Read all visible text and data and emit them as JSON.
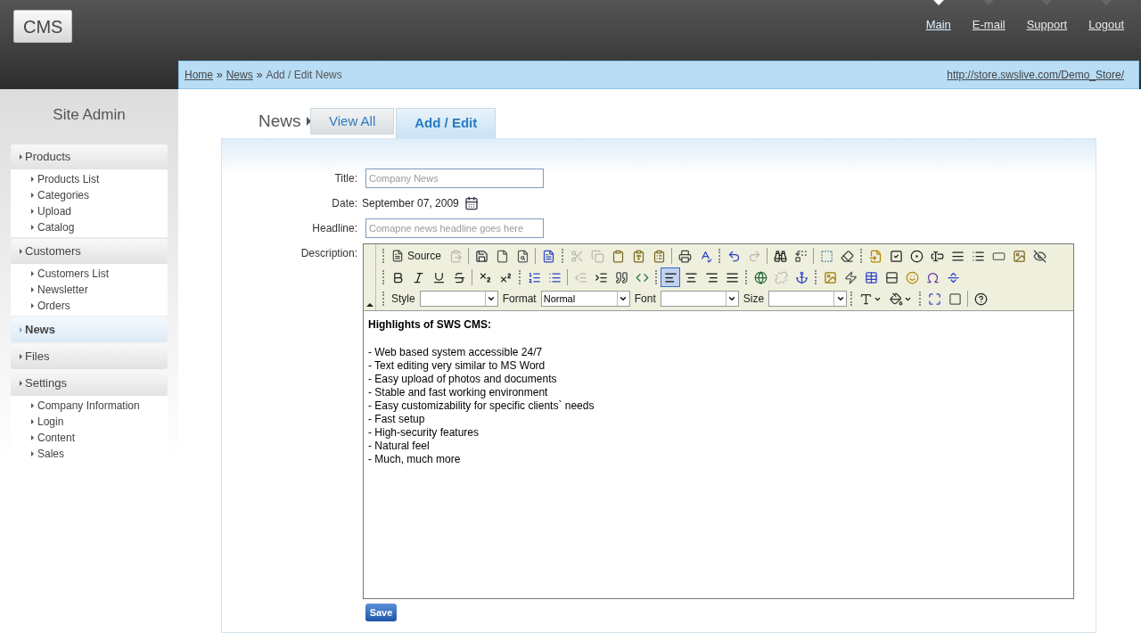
{
  "logo": "CMS",
  "nav": [
    {
      "label": "Main",
      "selected": true
    },
    {
      "label": "E-mail",
      "selected": false
    },
    {
      "label": "Support",
      "selected": false
    },
    {
      "label": "Logout",
      "selected": false
    }
  ],
  "breadcrumb": {
    "links": [
      "Home",
      "News"
    ],
    "separator": "»",
    "current": "Add / Edit News",
    "store_url": "http://store.swslive.com/Demo_Store/"
  },
  "sidebar": {
    "title": "Site Admin",
    "groups": [
      {
        "label": "Products",
        "selected": false,
        "children": [
          "Products List",
          "Categories",
          "Upload",
          "Catalog"
        ]
      },
      {
        "label": "Customers",
        "selected": false,
        "children": [
          "Customers List",
          "Newsletter",
          "Orders"
        ]
      },
      {
        "label": "News",
        "selected": true
      },
      {
        "label": "Files",
        "selected": false
      },
      {
        "label": "Settings",
        "selected": false,
        "children": [
          "Company Information",
          "Login",
          "Content",
          "Sales"
        ]
      }
    ]
  },
  "section": "News",
  "tabs": [
    {
      "label": "View All",
      "selected": false
    },
    {
      "label": "Add / Edit",
      "selected": true
    }
  ],
  "form": {
    "title": {
      "label": "Title:",
      "placeholder": "Company News"
    },
    "date": {
      "label": "Date:",
      "value": "September 07, 2009"
    },
    "headline": {
      "label": "Headline:",
      "placeholder": "Comapne news headline goes here"
    },
    "description": {
      "label": "Description:"
    }
  },
  "toolbar": {
    "rows": [
      [
        {
          "kind": "grip"
        },
        {
          "kind": "source",
          "label": "Source"
        },
        {
          "kind": "icon",
          "disabled": true,
          "selected": false
        },
        {
          "kind": "sep"
        },
        {
          "kind": "icon",
          "disabled": false,
          "selected": false
        },
        {
          "kind": "icon",
          "disabled": false,
          "selected": false
        },
        {
          "kind": "icon",
          "disabled": false,
          "selected": false
        },
        {
          "kind": "sep"
        },
        {
          "kind": "icon",
          "disabled": false,
          "selected": false
        },
        {
          "kind": "grip"
        },
        {
          "kind": "icon",
          "disabled": true,
          "selected": false
        },
        {
          "kind": "icon",
          "disabled": true,
          "selected": false
        },
        {
          "kind": "icon",
          "disabled": false,
          "selected": false
        },
        {
          "kind": "icon",
          "disabled": false,
          "selected": false
        },
        {
          "kind": "icon",
          "disabled": false,
          "selected": false
        },
        {
          "kind": "sep"
        },
        {
          "kind": "icon",
          "disabled": false,
          "selected": false
        },
        {
          "kind": "icon",
          "disabled": false,
          "selected": false
        },
        {
          "kind": "grip"
        },
        {
          "kind": "icon",
          "disabled": false,
          "selected": false
        },
        {
          "kind": "icon",
          "disabled": true,
          "selected": false
        },
        {
          "kind": "sep"
        },
        {
          "kind": "icon",
          "disabled": false,
          "selected": false
        },
        {
          "kind": "icon",
          "disabled": false,
          "selected": false
        },
        {
          "kind": "sep"
        },
        {
          "kind": "icon",
          "disabled": false,
          "selected": false
        },
        {
          "kind": "icon",
          "disabled": false,
          "selected": false
        },
        {
          "kind": "grip"
        },
        {
          "kind": "icon",
          "disabled": false,
          "selected": false
        },
        {
          "kind": "icon",
          "disabled": false,
          "selected": false
        },
        {
          "kind": "icon",
          "disabled": false,
          "selected": false
        },
        {
          "kind": "icon",
          "disabled": false,
          "selected": false
        },
        {
          "kind": "icon",
          "disabled": false,
          "selected": false
        },
        {
          "kind": "icon",
          "disabled": false,
          "selected": false
        },
        {
          "kind": "icon",
          "disabled": false,
          "selected": false
        },
        {
          "kind": "icon",
          "disabled": false,
          "selected": false
        },
        {
          "kind": "icon",
          "disabled": false,
          "selected": false
        }
      ],
      [
        {
          "kind": "grip"
        },
        {
          "kind": "icon",
          "disabled": false,
          "selected": false
        },
        {
          "kind": "icon",
          "disabled": false,
          "selected": false
        },
        {
          "kind": "icon",
          "disabled": false,
          "selected": false
        },
        {
          "kind": "icon",
          "disabled": false,
          "selected": false
        },
        {
          "kind": "sep"
        },
        {
          "kind": "icon",
          "disabled": false,
          "selected": false
        },
        {
          "kind": "icon",
          "disabled": false,
          "selected": false
        },
        {
          "kind": "grip"
        },
        {
          "kind": "icon",
          "disabled": false,
          "selected": false
        },
        {
          "kind": "icon",
          "disabled": false,
          "selected": false
        },
        {
          "kind": "sep"
        },
        {
          "kind": "icon",
          "disabled": true,
          "selected": false
        },
        {
          "kind": "icon",
          "disabled": false,
          "selected": false
        },
        {
          "kind": "icon",
          "disabled": false,
          "selected": false
        },
        {
          "kind": "icon",
          "disabled": false,
          "selected": false
        },
        {
          "kind": "grip"
        },
        {
          "kind": "icon",
          "disabled": false,
          "selected": true
        },
        {
          "kind": "icon",
          "disabled": false,
          "selected": false
        },
        {
          "kind": "icon",
          "disabled": false,
          "selected": false
        },
        {
          "kind": "icon",
          "disabled": false,
          "selected": false
        },
        {
          "kind": "grip"
        },
        {
          "kind": "icon",
          "disabled": false,
          "selected": false
        },
        {
          "kind": "icon",
          "disabled": true,
          "selected": false
        },
        {
          "kind": "icon",
          "disabled": false,
          "selected": false
        },
        {
          "kind": "grip"
        },
        {
          "kind": "icon",
          "disabled": false,
          "selected": false
        },
        {
          "kind": "icon",
          "disabled": false,
          "selected": false
        },
        {
          "kind": "icon",
          "disabled": false,
          "selected": false
        },
        {
          "kind": "icon",
          "disabled": false,
          "selected": false
        },
        {
          "kind": "icon",
          "disabled": false,
          "selected": false
        },
        {
          "kind": "icon",
          "disabled": false,
          "selected": false
        },
        {
          "kind": "icon",
          "disabled": false,
          "selected": false
        }
      ],
      [
        {
          "kind": "grip"
        },
        {
          "kind": "label",
          "label": "Style"
        },
        {
          "kind": "select"
        },
        {
          "kind": "label",
          "label": "Format"
        },
        {
          "kind": "select",
          "value": "Normal"
        },
        {
          "kind": "label",
          "label": "Font"
        },
        {
          "kind": "select"
        },
        {
          "kind": "label",
          "label": "Size"
        },
        {
          "kind": "select"
        },
        {
          "kind": "grip"
        },
        {
          "kind": "color"
        },
        {
          "kind": "color"
        },
        {
          "kind": "grip"
        },
        {
          "kind": "icon",
          "disabled": false,
          "selected": false
        },
        {
          "kind": "icon",
          "disabled": false,
          "selected": false
        },
        {
          "kind": "sep"
        },
        {
          "kind": "icon",
          "disabled": false,
          "selected": false
        }
      ]
    ]
  },
  "editor": {
    "heading": "Highlights of SWS CMS:",
    "lines": [
      "- Web based system accessible 24/7",
      "- Text editing very similar to MS Word",
      "- Easy upload of photos and documents",
      "- Stable and fast working environment",
      "- Easy customizability for specific clients` needs",
      "- Fast setup",
      "- High-security features",
      "- Natural feel",
      "- Much, much more"
    ]
  },
  "save_button": "Save"
}
